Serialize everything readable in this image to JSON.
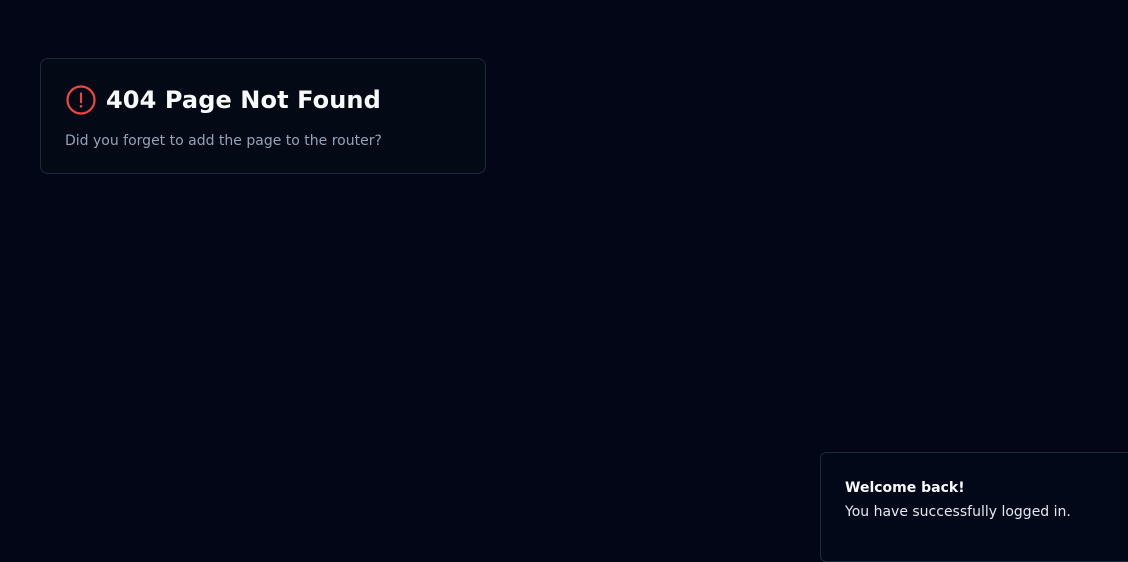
{
  "not_found": {
    "icon": "alert-circle-icon",
    "icon_color": "#ef4444",
    "title": "404 Page Not Found",
    "description": "Did you forget to add the page to the router?"
  },
  "toast": {
    "title": "Welcome back!",
    "message": "You have successfully logged in."
  },
  "colors": {
    "background": "#020617",
    "card_border": "#1e293b",
    "muted_text": "#94a3b8",
    "text": "#f8fafc"
  }
}
